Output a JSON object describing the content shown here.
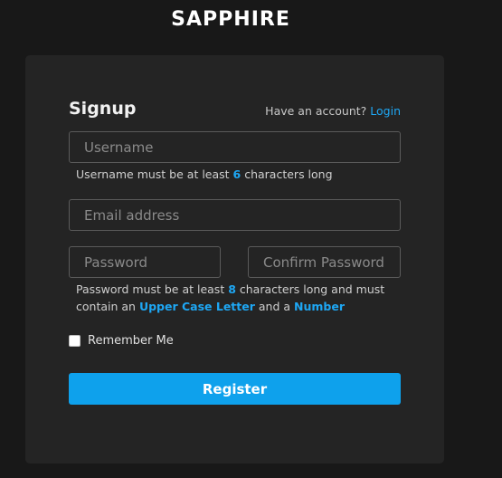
{
  "brand": {
    "logo_text": "SAPPHIRE"
  },
  "form": {
    "title": "Signup",
    "have_account_text": "Have an account?",
    "login_link": "Login",
    "username": {
      "placeholder": "Username",
      "value": ""
    },
    "username_hint": {
      "prefix": "Username must be at least ",
      "min": "6",
      "suffix": " characters long"
    },
    "email": {
      "placeholder": "Email address",
      "value": ""
    },
    "password": {
      "placeholder": "Password",
      "value": ""
    },
    "confirm_password": {
      "placeholder": "Confirm Password",
      "value": ""
    },
    "password_hint": {
      "line1_prefix": "Password must be at least ",
      "min": "8",
      "line1_suffix": " characters long and must",
      "line2_prefix": "contain an ",
      "req1": "Upper Case Letter",
      "line2_mid": " and a ",
      "req2": "Number"
    },
    "remember_label": "Remember Me",
    "remember_checked": false,
    "register_label": "Register"
  },
  "colors": {
    "background": "#181818",
    "card": "#242424",
    "accent": "#0ea1ec",
    "link": "#1ea7f4"
  }
}
